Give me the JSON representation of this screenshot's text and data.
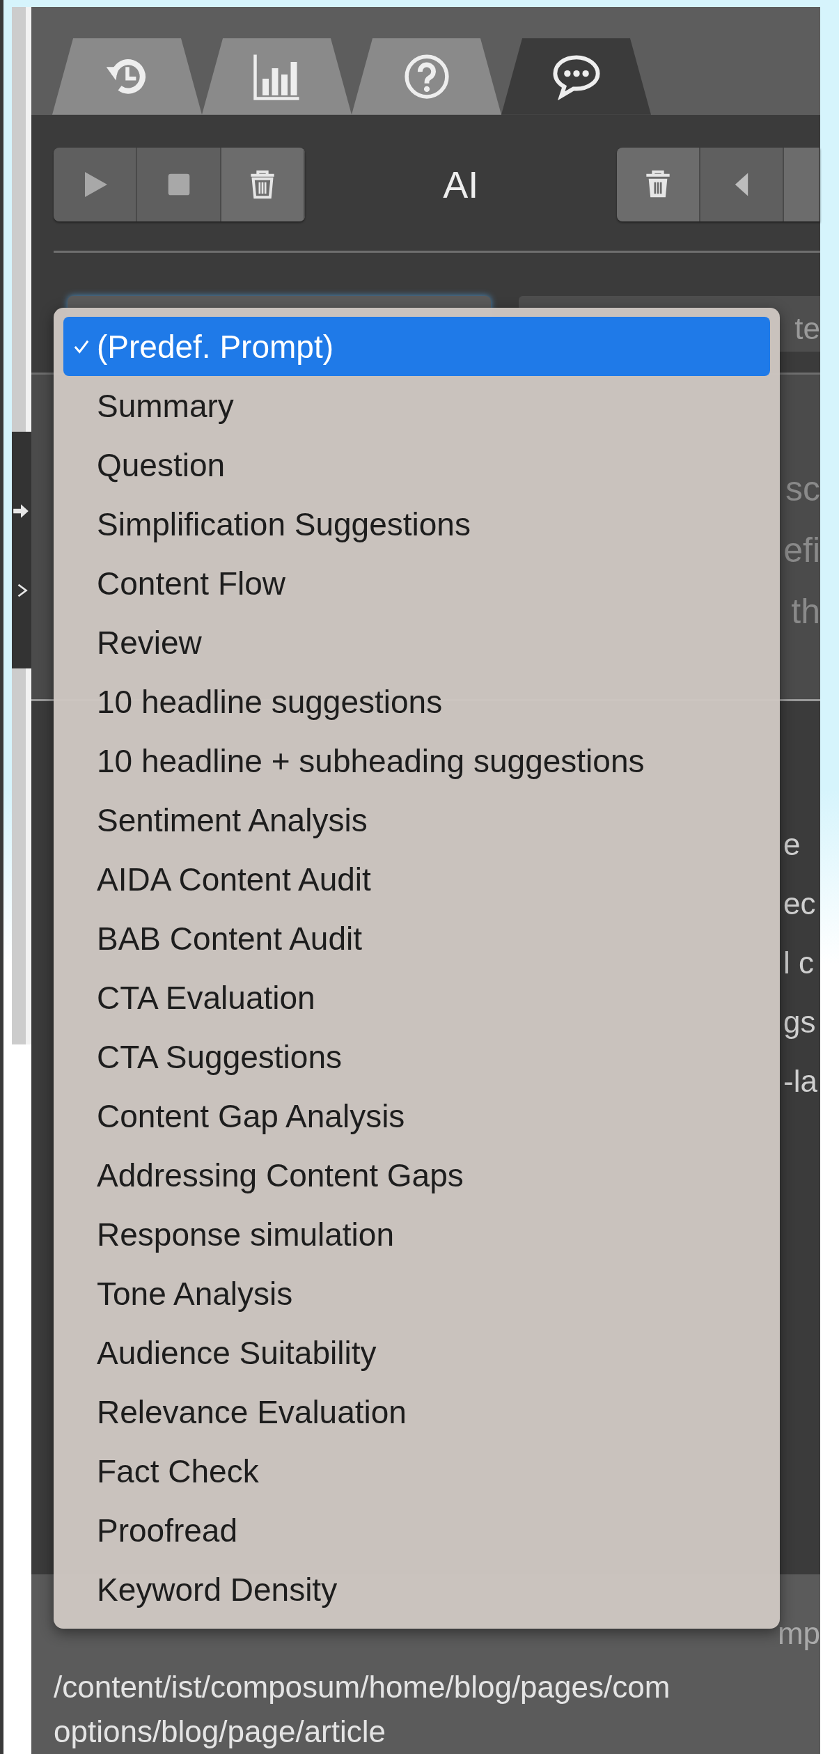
{
  "tabs": [
    {
      "kind": "history",
      "selected": false
    },
    {
      "kind": "chart",
      "selected": false
    },
    {
      "kind": "help",
      "selected": false
    },
    {
      "kind": "chat",
      "selected": true
    }
  ],
  "toolbar": {
    "left_buttons": [
      {
        "kind": "play"
      },
      {
        "kind": "stop"
      },
      {
        "kind": "trash"
      }
    ],
    "title": "AI",
    "right_buttons": [
      {
        "kind": "trash"
      },
      {
        "kind": "prev"
      }
    ]
  },
  "prompt_field_fragment": "te",
  "textarea_fragments": [
    "sc",
    "efi",
    "th"
  ],
  "response_fragments": [
    "e",
    "ec",
    "l c",
    "gs",
    "-la"
  ],
  "header_fragment": "mp",
  "path_lines": [
    "/content/ist/composum/home/blog/pages/com",
    "options/blog/page/article"
  ],
  "menu": {
    "items": [
      {
        "label": "(Predef. Prompt)",
        "selected": true
      },
      {
        "label": "Summary",
        "selected": false
      },
      {
        "label": "Question",
        "selected": false
      },
      {
        "label": "Simplification Suggestions",
        "selected": false
      },
      {
        "label": "Content Flow",
        "selected": false
      },
      {
        "label": "Review",
        "selected": false
      },
      {
        "label": "10 headline suggestions",
        "selected": false
      },
      {
        "label": "10 headline + subheading suggestions",
        "selected": false
      },
      {
        "label": "Sentiment Analysis",
        "selected": false
      },
      {
        "label": "AIDA Content Audit",
        "selected": false
      },
      {
        "label": "BAB Content Audit",
        "selected": false
      },
      {
        "label": "CTA Evaluation",
        "selected": false
      },
      {
        "label": "CTA Suggestions",
        "selected": false
      },
      {
        "label": "Content Gap Analysis",
        "selected": false
      },
      {
        "label": "Addressing Content Gaps",
        "selected": false
      },
      {
        "label": "Response simulation",
        "selected": false
      },
      {
        "label": "Tone Analysis",
        "selected": false
      },
      {
        "label": "Audience Suitability",
        "selected": false
      },
      {
        "label": "Relevance Evaluation",
        "selected": false
      },
      {
        "label": "Fact Check",
        "selected": false
      },
      {
        "label": "Proofread",
        "selected": false
      },
      {
        "label": "Keyword Density",
        "selected": false
      }
    ]
  }
}
